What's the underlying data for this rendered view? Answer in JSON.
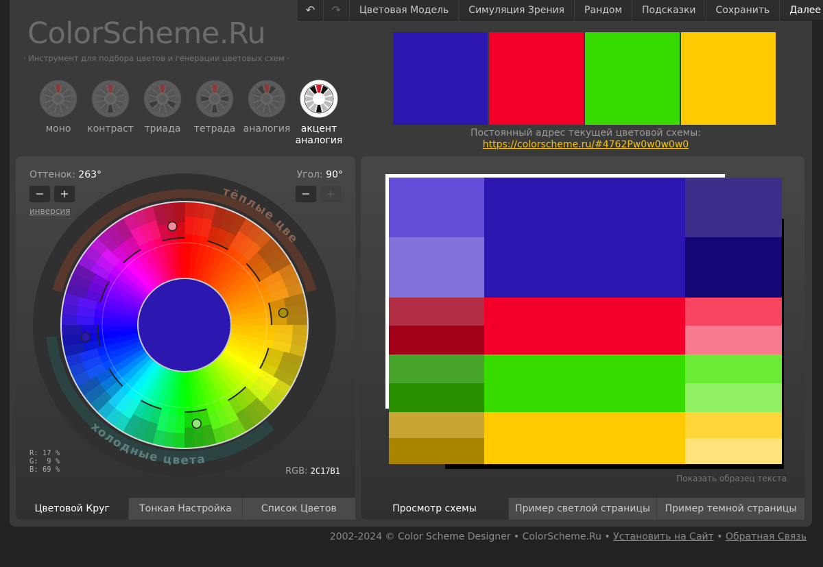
{
  "logo": {
    "title": "ColorScheme.Ru",
    "tagline": "· Инструмент для подбора цветов и генерации цветовых схем ·"
  },
  "menu": {
    "undo_icon": "undo-icon",
    "redo_icon": "redo-icon",
    "items": [
      "Цветовая Модель",
      "Симуляция Зрения",
      "Рандом",
      "Подсказки",
      "Сохранить",
      "Далее ..."
    ]
  },
  "modes": [
    {
      "label": "моно"
    },
    {
      "label": "контраст"
    },
    {
      "label": "триада"
    },
    {
      "label": "тетрада"
    },
    {
      "label": "аналогия"
    },
    {
      "label": "акцент аналогия",
      "active": true
    }
  ],
  "swatches": [
    "#2C17B1",
    "#F2002A",
    "#37DB00",
    "#FFCB00"
  ],
  "permalink": {
    "label": "Постоянный адрес текущей цветовой схемы:",
    "url": "https://colorscheme.ru/#4762Pw0w0w0w0"
  },
  "wheel_panel": {
    "hue_label": "Оттенок:",
    "hue_value": "263°",
    "angle_label": "Угол:",
    "angle_value": "90°",
    "minus": "−",
    "plus": "+",
    "inversion": "инверсия",
    "warm_label": "тёплые цвета",
    "cold_label": "холодные цвета",
    "rgb": {
      "r": "R: 17 %",
      "g": "G:  9 %",
      "b": "B: 69 %"
    },
    "rgb_hex_label": "RGB:",
    "rgb_hex": "2C17B1",
    "center_color": "#2C17B1",
    "markers": [
      {
        "name": "primary",
        "angle_deg": 263,
        "color": "#2C17B1"
      },
      {
        "name": "complement-1",
        "angle_deg": 353,
        "color": "#F08C9E"
      },
      {
        "name": "complement-2",
        "angle_deg": 83,
        "color": "#A79000"
      },
      {
        "name": "complement-3",
        "angle_deg": 173,
        "color": "#8FE877"
      }
    ],
    "tabs": [
      "Цветовой Круг",
      "Тонкая Настройка",
      "Список Цветов"
    ]
  },
  "preview_panel": {
    "sample_text": "Показать образец текста",
    "tabs": [
      "Просмотр схемы",
      "Пример светлой страницы",
      "Пример темной страницы"
    ],
    "rows": [
      {
        "left": [
          "#624ED9",
          "#8273DA"
        ],
        "main": "#2C17B1",
        "right": [
          "#3E2E8C",
          "#140674"
        ]
      },
      {
        "left": [
          "#B12E45",
          "#A10019"
        ],
        "main": "#F2002A",
        "right": [
          "#F64461",
          "#F77A8E"
        ]
      },
      {
        "left": [
          "#47A42A",
          "#278F00"
        ],
        "main": "#37DB00",
        "right": [
          "#6AEC37",
          "#90F064"
        ]
      },
      {
        "left": [
          "#C8A534",
          "#AA8500"
        ],
        "main": "#FFCB00",
        "right": [
          "#FFD63A",
          "#FFE17A"
        ]
      }
    ]
  },
  "footer": {
    "copyright": "2002-2024 © Color Scheme Designer • ColorScheme.Ru •",
    "install_link": "Установить на Сайт",
    "separator": "•",
    "feedback_link": "Обратная Связь"
  }
}
